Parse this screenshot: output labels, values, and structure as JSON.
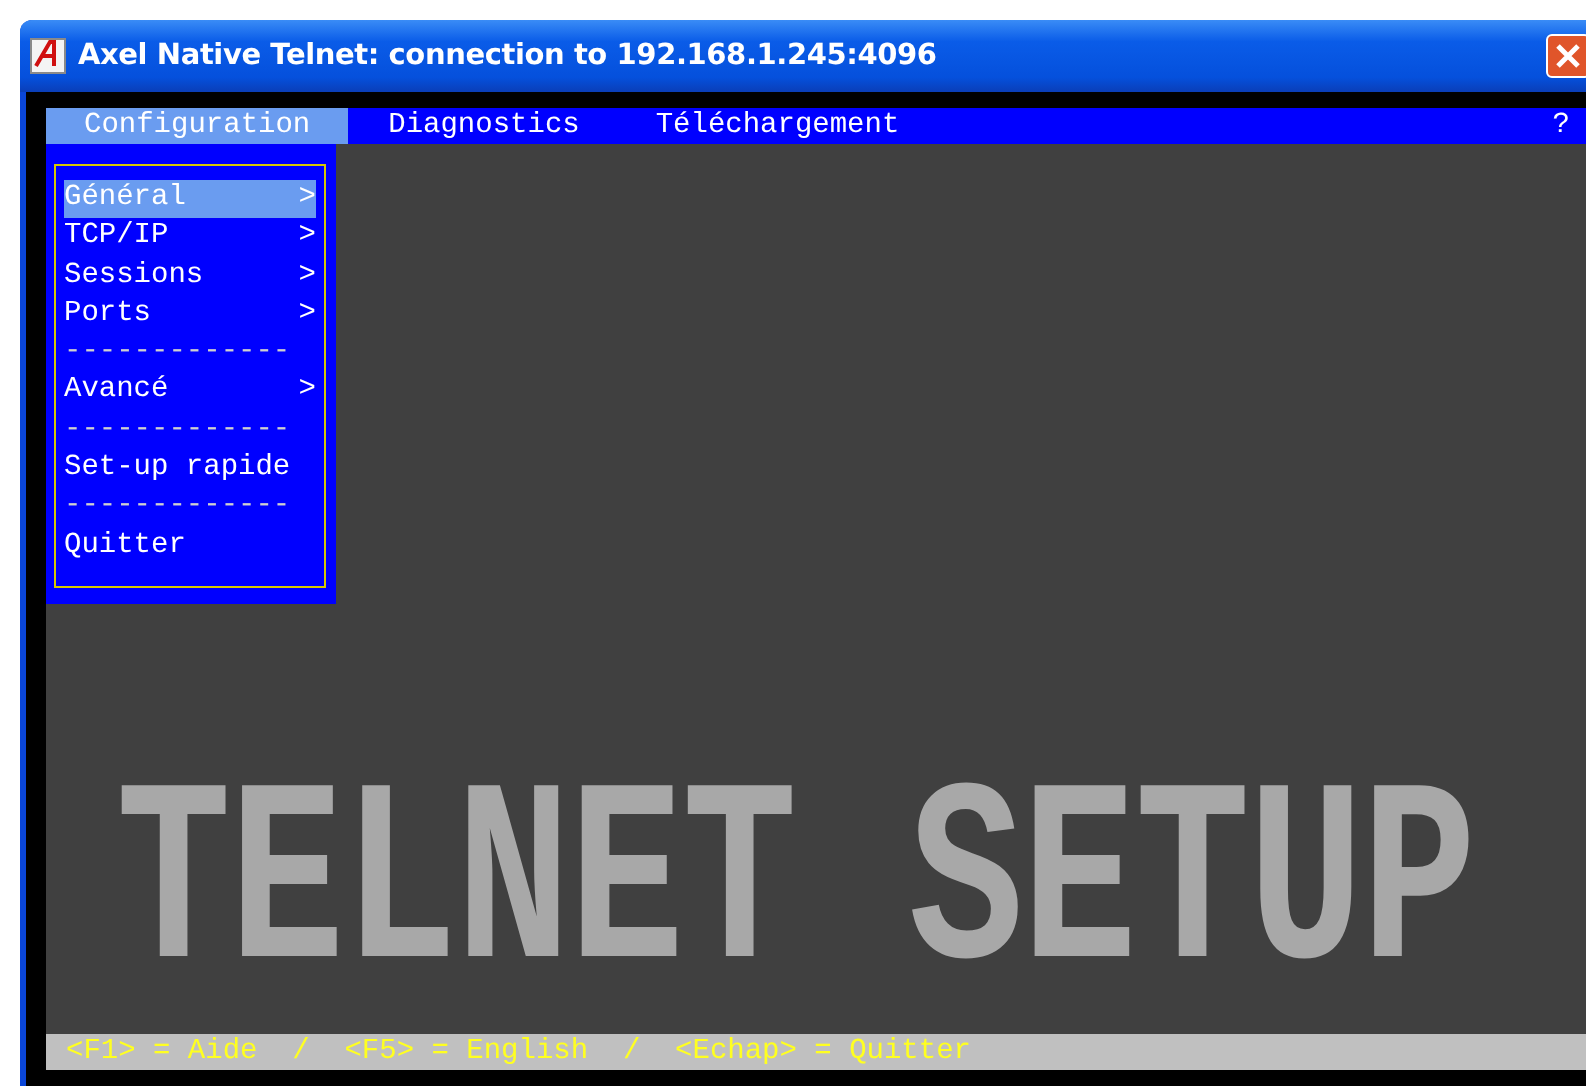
{
  "window": {
    "title": "Axel Native Telnet: connection to 192.168.1.245:4096"
  },
  "menu_bar": {
    "items": [
      {
        "label": "Configuration",
        "selected": true
      },
      {
        "label": "Diagnostics",
        "selected": false
      },
      {
        "label": "Téléchargement",
        "selected": false
      }
    ],
    "help": "?"
  },
  "dropdown": {
    "items": [
      {
        "kind": "item",
        "label": "Général",
        "arrow": ">",
        "selected": true
      },
      {
        "kind": "item",
        "label": "TCP/IP",
        "arrow": ">",
        "selected": false
      },
      {
        "kind": "item",
        "label": "Sessions",
        "arrow": ">",
        "selected": false
      },
      {
        "kind": "item",
        "label": "Ports",
        "arrow": ">",
        "selected": false
      },
      {
        "kind": "separator",
        "label": "-------------"
      },
      {
        "kind": "item",
        "label": "Avancé",
        "arrow": ">",
        "selected": false
      },
      {
        "kind": "separator",
        "label": "-------------"
      },
      {
        "kind": "item",
        "label": "Set-up rapide",
        "selected": false
      },
      {
        "kind": "separator",
        "label": "-------------"
      },
      {
        "kind": "item",
        "label": "Quitter",
        "selected": false
      }
    ]
  },
  "banner": "TELNET SETUP",
  "status_bar": "<F1> = Aide  /  <F5> = English  /  <Echap> = Quitter"
}
